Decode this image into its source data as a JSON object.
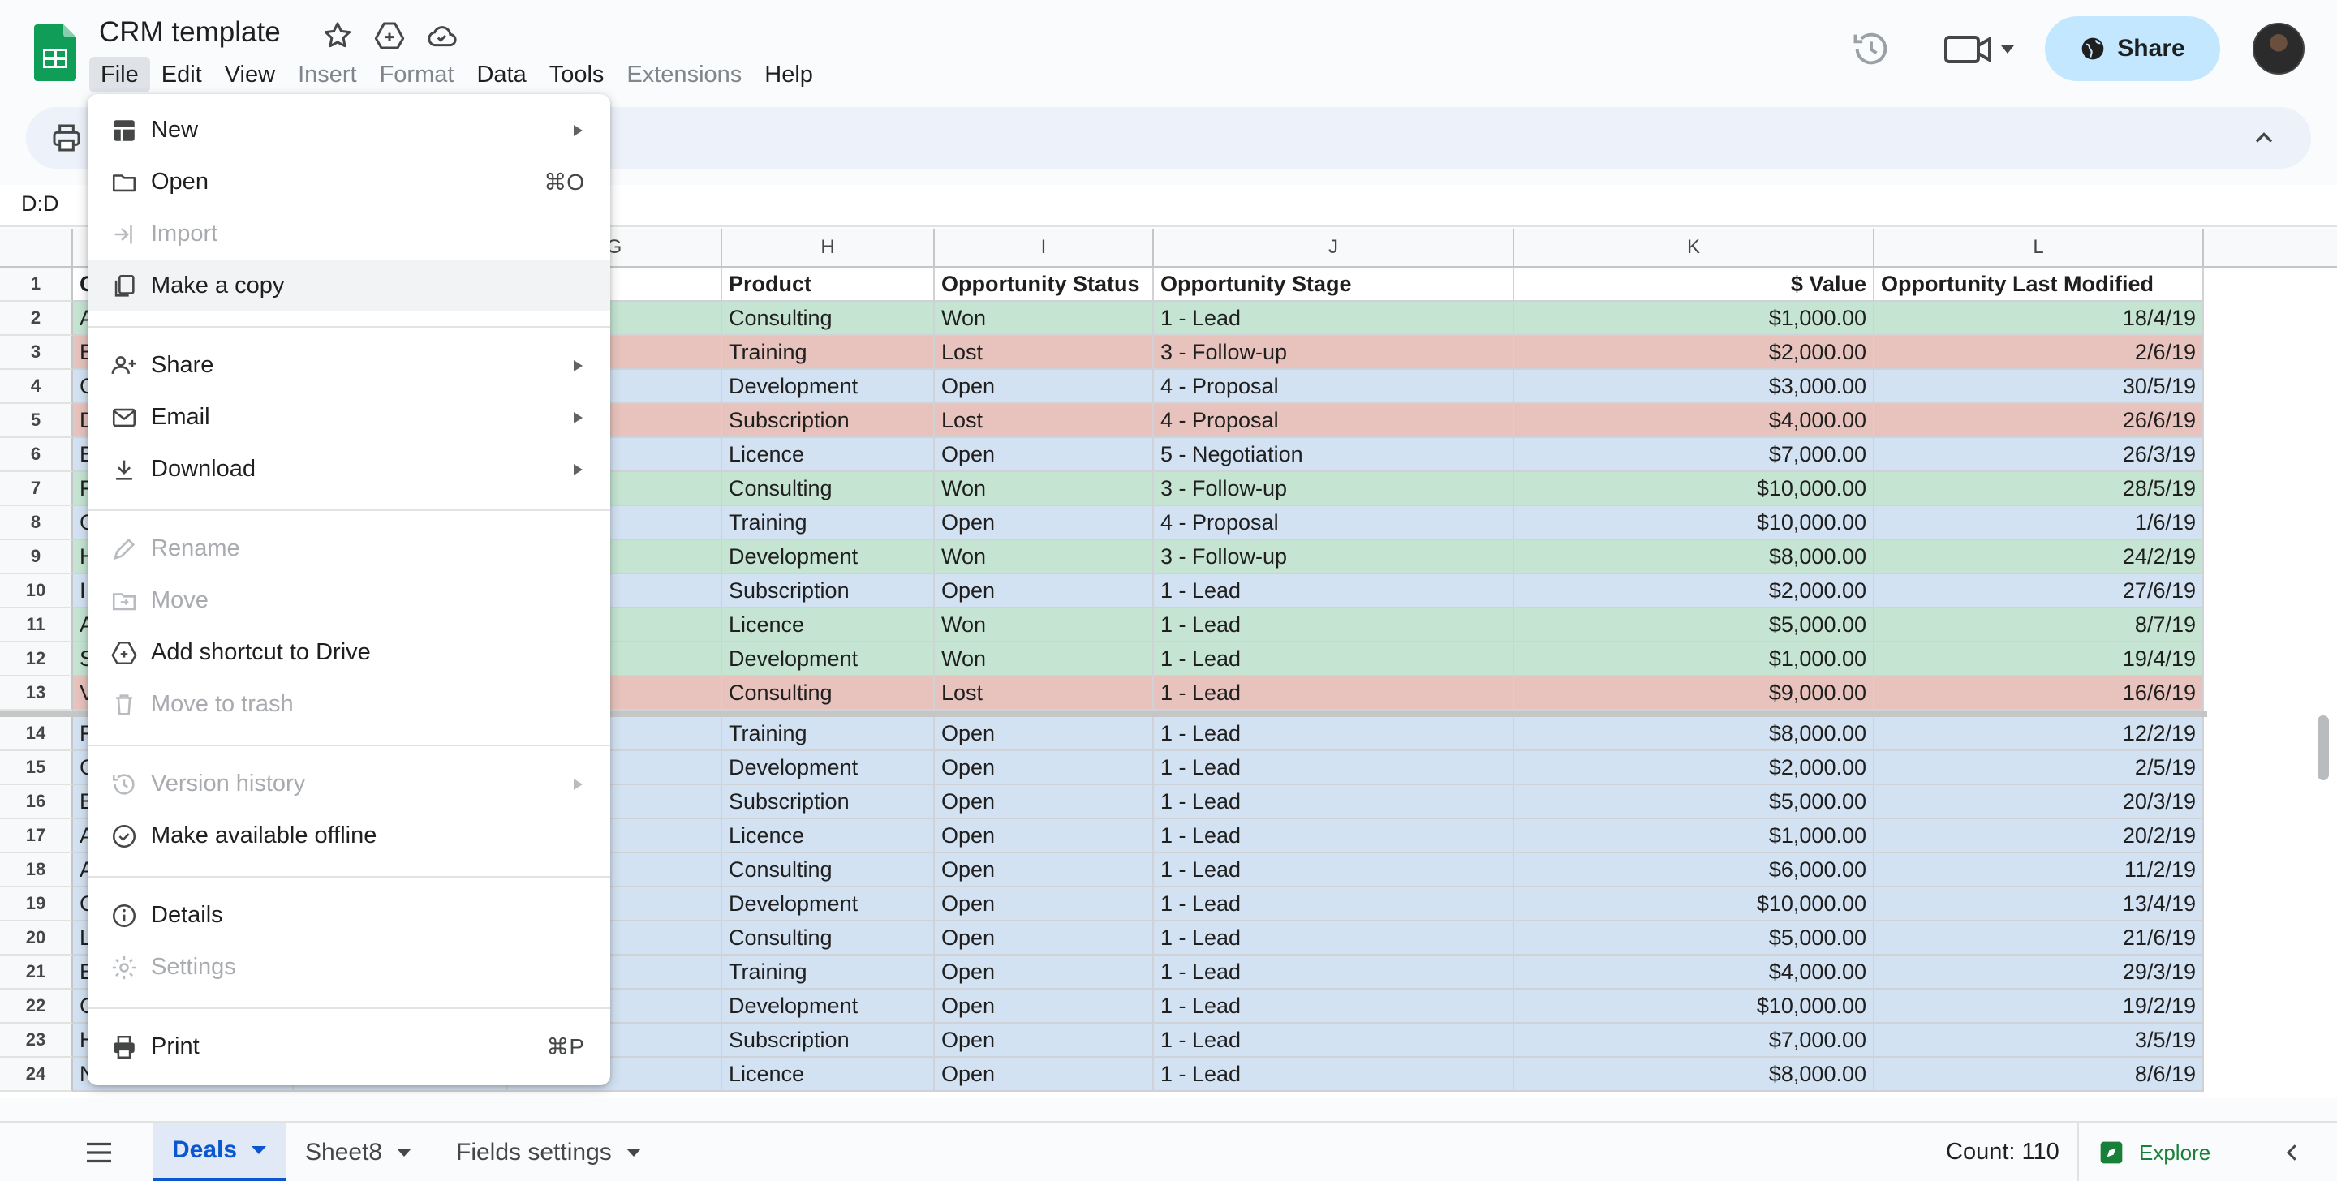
{
  "doc": {
    "title": "CRM template"
  },
  "menubar": [
    "File",
    "Edit",
    "View",
    "Insert",
    "Format",
    "Data",
    "Tools",
    "Extensions",
    "Help"
  ],
  "share": {
    "label": "Share"
  },
  "name_box": "D:D",
  "columns": [
    "G",
    "H",
    "I",
    "J",
    "K",
    "L"
  ],
  "headers": {
    "product": "Product",
    "status": "Opportunity Status",
    "stage": "Opportunity Stage",
    "value": "$ Value",
    "modified": "Opportunity Last Modified"
  },
  "first_col_letters": [
    "C",
    "A",
    "B",
    "C",
    "D",
    "E",
    "F",
    "G",
    "H",
    "I",
    "A",
    "S",
    "V",
    "F",
    "G",
    "B",
    "A",
    "A",
    "C",
    "L",
    "E",
    "C",
    "H",
    "N"
  ],
  "rows": [
    {
      "n": "2",
      "product": "Consulting",
      "status": "Won",
      "stage": "1 - Lead",
      "value": "$1,000.00",
      "modified": "18/4/19"
    },
    {
      "n": "3",
      "product": "Training",
      "status": "Lost",
      "stage": "3 - Follow-up",
      "value": "$2,000.00",
      "modified": "2/6/19"
    },
    {
      "n": "4",
      "product": "Development",
      "status": "Open",
      "stage": "4 - Proposal",
      "value": "$3,000.00",
      "modified": "30/5/19"
    },
    {
      "n": "5",
      "product": "Subscription",
      "status": "Lost",
      "stage": "4 - Proposal",
      "value": "$4,000.00",
      "modified": "26/6/19"
    },
    {
      "n": "6",
      "product": "Licence",
      "status": "Open",
      "stage": "5 - Negotiation",
      "value": "$7,000.00",
      "modified": "26/3/19"
    },
    {
      "n": "7",
      "product": "Consulting",
      "status": "Won",
      "stage": "3 - Follow-up",
      "value": "$10,000.00",
      "modified": "28/5/19"
    },
    {
      "n": "8",
      "product": "Training",
      "status": "Open",
      "stage": "4 - Proposal",
      "value": "$10,000.00",
      "modified": "1/6/19"
    },
    {
      "n": "9",
      "product": "Development",
      "status": "Won",
      "stage": "3 - Follow-up",
      "value": "$8,000.00",
      "modified": "24/2/19"
    },
    {
      "n": "10",
      "product": "Subscription",
      "status": "Open",
      "stage": "1 - Lead",
      "value": "$2,000.00",
      "modified": "27/6/19"
    },
    {
      "n": "11",
      "product": "Licence",
      "status": "Won",
      "stage": "1 - Lead",
      "value": "$5,000.00",
      "modified": "8/7/19"
    },
    {
      "n": "12",
      "product": "Development",
      "status": "Won",
      "stage": "1 - Lead",
      "value": "$1,000.00",
      "modified": "19/4/19"
    },
    {
      "n": "13",
      "product": "Consulting",
      "status": "Lost",
      "stage": "1 - Lead",
      "value": "$9,000.00",
      "modified": "16/6/19"
    },
    {
      "n": "14",
      "product": "Training",
      "status": "Open",
      "stage": "1 - Lead",
      "value": "$8,000.00",
      "modified": "12/2/19"
    },
    {
      "n": "15",
      "product": "Development",
      "status": "Open",
      "stage": "1 - Lead",
      "value": "$2,000.00",
      "modified": "2/5/19"
    },
    {
      "n": "16",
      "product": "Subscription",
      "status": "Open",
      "stage": "1 - Lead",
      "value": "$5,000.00",
      "modified": "20/3/19"
    },
    {
      "n": "17",
      "product": "Licence",
      "status": "Open",
      "stage": "1 - Lead",
      "value": "$1,000.00",
      "modified": "20/2/19"
    },
    {
      "n": "18",
      "product": "Consulting",
      "status": "Open",
      "stage": "1 - Lead",
      "value": "$6,000.00",
      "modified": "11/2/19"
    },
    {
      "n": "19",
      "product": "Development",
      "status": "Open",
      "stage": "1 - Lead",
      "value": "$10,000.00",
      "modified": "13/4/19"
    },
    {
      "n": "20",
      "product": "Consulting",
      "status": "Open",
      "stage": "1 - Lead",
      "value": "$5,000.00",
      "modified": "21/6/19"
    },
    {
      "n": "21",
      "product": "Training",
      "status": "Open",
      "stage": "1 - Lead",
      "value": "$4,000.00",
      "modified": "29/3/19"
    },
    {
      "n": "22",
      "product": "Development",
      "status": "Open",
      "stage": "1 - Lead",
      "value": "$10,000.00",
      "modified": "19/2/19"
    },
    {
      "n": "23",
      "product": "Subscription",
      "status": "Open",
      "stage": "1 - Lead",
      "value": "$7,000.00",
      "modified": "3/5/19"
    },
    {
      "n": "24",
      "product": "Licence",
      "status": "Open",
      "stage": "1 - Lead",
      "value": "$8,000.00",
      "modified": "8/6/19"
    }
  ],
  "file_menu": {
    "new": "New",
    "open": "Open",
    "open_shortcut": "⌘O",
    "import": "Import",
    "make_copy": "Make a copy",
    "share": "Share",
    "email": "Email",
    "download": "Download",
    "rename": "Rename",
    "move": "Move",
    "add_shortcut": "Add shortcut to Drive",
    "trash": "Move to trash",
    "version_history": "Version history",
    "offline": "Make available offline",
    "details": "Details",
    "settings": "Settings",
    "print": "Print",
    "print_shortcut": "⌘P"
  },
  "sheets": [
    "Deals",
    "Sheet8",
    "Fields settings"
  ],
  "status": {
    "count": "Count: 110",
    "explore": "Explore"
  },
  "colors": {
    "open": "#d3e2f2",
    "won": "#c5e4d2",
    "lost": "#e8c3bd",
    "accent": "#0b57d0",
    "share_bg": "#c2e7ff"
  }
}
